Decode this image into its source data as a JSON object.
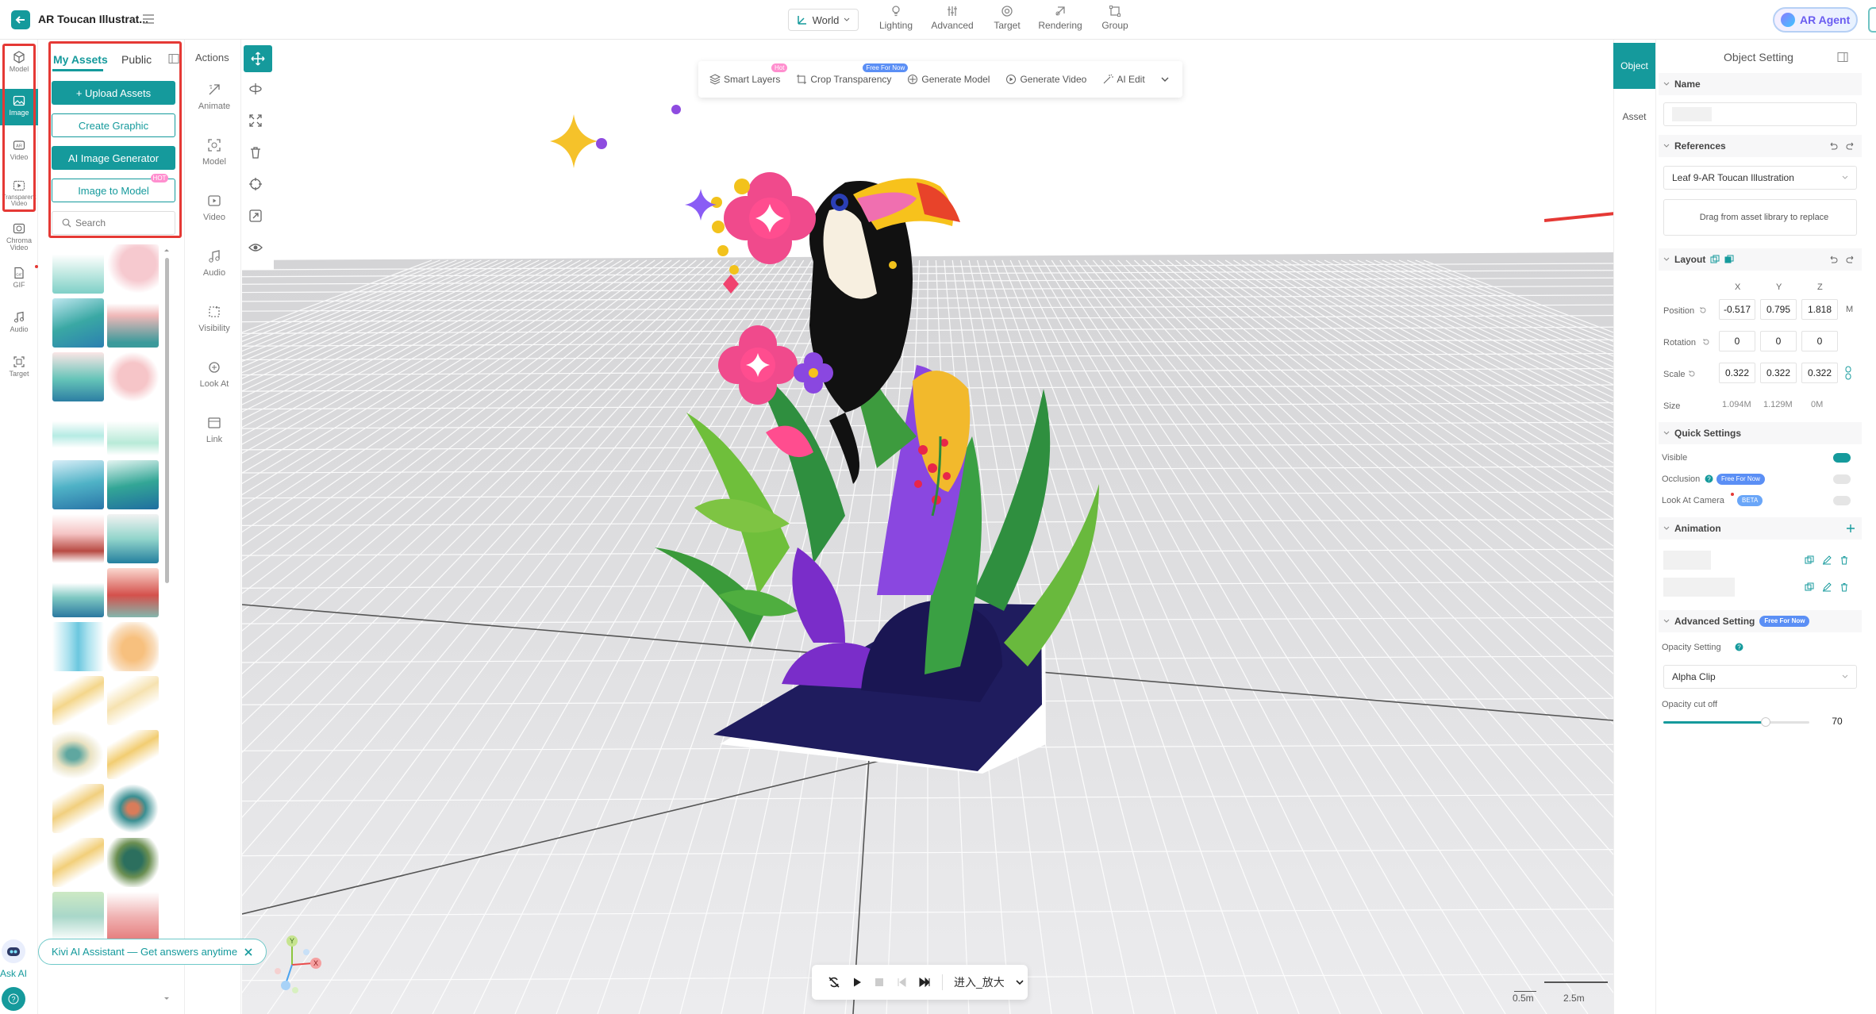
{
  "topbar": {
    "title": "AR Toucan Illustrat...",
    "world_label": "World",
    "items": [
      {
        "label": "Lighting"
      },
      {
        "label": "Advanced"
      },
      {
        "label": "Target"
      },
      {
        "label": "Rendering"
      },
      {
        "label": "Group"
      }
    ],
    "agent_label": "AR Agent"
  },
  "rail": {
    "items": [
      {
        "label": "Model",
        "icon": "cube-icon"
      },
      {
        "label": "Image",
        "icon": "image-icon"
      },
      {
        "label": "Video",
        "icon": "ar-video-icon"
      },
      {
        "label": "Transparent Video",
        "icon": "transparent-video-icon"
      },
      {
        "label": "Chroma Video",
        "icon": "chroma-video-icon"
      },
      {
        "label": "GIF",
        "icon": "gif-icon"
      },
      {
        "label": "Audio",
        "icon": "music-note-icon"
      },
      {
        "label": "Target",
        "icon": "target-icon"
      }
    ]
  },
  "assets": {
    "tab_my": "My Assets",
    "tab_public": "Public",
    "upload": "+ Upload Assets",
    "create_graphic": "Create Graphic",
    "ai_generator": "AI Image Generator",
    "image_to_model": "Image to Model",
    "hot": "HOT",
    "search_placeholder": "Search"
  },
  "actions": {
    "title": "Actions",
    "items": [
      {
        "label": "Animate"
      },
      {
        "label": "Model"
      },
      {
        "label": "Video"
      },
      {
        "label": "Audio"
      },
      {
        "label": "Visibility"
      },
      {
        "label": "Look At"
      },
      {
        "label": "Link"
      }
    ]
  },
  "viewport_toolbar": {
    "items": [
      {
        "label": "Smart Layers",
        "badge": "Hot"
      },
      {
        "label": "Crop Transparency",
        "badge": "Free For Now"
      },
      {
        "label": "Generate Model"
      },
      {
        "label": "Generate Video"
      },
      {
        "label": "AI Edit"
      }
    ]
  },
  "playbar": {
    "mode": "进入_放大"
  },
  "scale": {
    "a": "0.5m",
    "b": "2.5m"
  },
  "axis": {
    "y": "Y",
    "x": "X"
  },
  "side_tabs": {
    "object": "Object",
    "asset": "Asset"
  },
  "panel": {
    "title": "Object Setting",
    "name_hdr": "Name",
    "refs_hdr": "References",
    "ref_value": "Leaf 9-AR Toucan Illustration",
    "drag_hint": "Drag from asset library to replace",
    "layout_hdr": "Layout",
    "axes": [
      "X",
      "Y",
      "Z"
    ],
    "position_label": "Position",
    "rotation_label": "Rotation",
    "scale_label": "Scale",
    "size_label": "Size",
    "position": [
      "-0.517",
      "0.795",
      "1.818"
    ],
    "rotation": [
      "0",
      "0",
      "0"
    ],
    "scale": [
      "0.322",
      "0.322",
      "0.322"
    ],
    "size": [
      "1.094M",
      "1.129M",
      "0M"
    ],
    "unit": "M",
    "quick_hdr": "Quick Settings",
    "visible": "Visible",
    "occlusion": "Occlusion",
    "free_badge": "Free For Now",
    "look_at_camera": "Look At Camera",
    "beta": "BETA",
    "anim_hdr": "Animation",
    "adv_hdr": "Advanced Setting",
    "opacity_setting": "Opacity Setting",
    "opacity_mode": "Alpha Clip",
    "opacity_cutoff_label": "Opacity cut off",
    "opacity_cutoff": "70",
    "opacity_cutoff_fraction": 0.7
  },
  "ask_ai": {
    "bubble": "Kivi AI Assistant — Get answers anytime",
    "label": "Ask AI"
  },
  "colors": {
    "accent": "#159a9c",
    "annotation": "#e53935",
    "agent": "#6a5cf0"
  }
}
